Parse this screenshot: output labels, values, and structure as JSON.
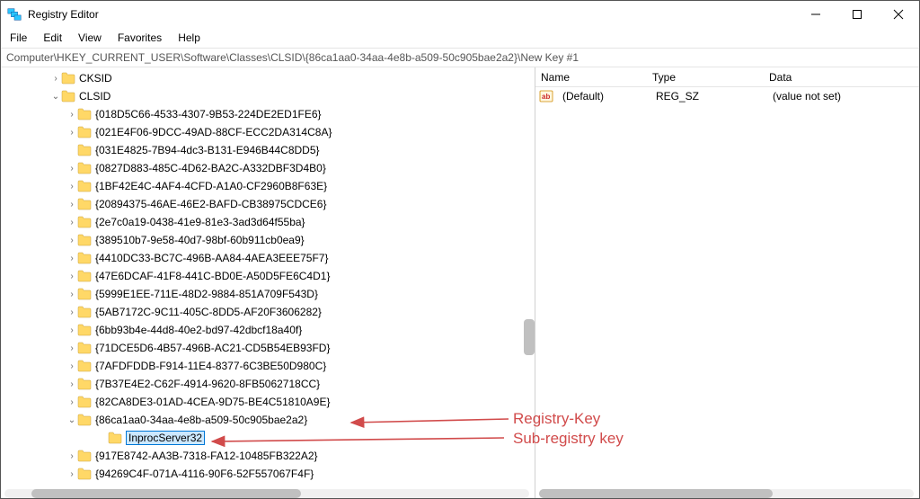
{
  "window_title": "Registry Editor",
  "menu": {
    "file": "File",
    "edit": "Edit",
    "view": "View",
    "favorites": "Favorites",
    "help": "Help"
  },
  "address_path": "Computer\\HKEY_CURRENT_USER\\Software\\Classes\\CLSID\\{86ca1aa0-34aa-4e8b-a509-50c905bae2a2}\\New Key #1",
  "tree": {
    "top1": "CKSID",
    "clsid": "CLSID",
    "keys": [
      "{018D5C66-4533-4307-9B53-224DE2ED1FE6}",
      "{021E4F06-9DCC-49AD-88CF-ECC2DA314C8A}",
      "{031E4825-7B94-4dc3-B131-E946B44C8DD5}",
      "{0827D883-485C-4D62-BA2C-A332DBF3D4B0}",
      "{1BF42E4C-4AF4-4CFD-A1A0-CF2960B8F63E}",
      "{20894375-46AE-46E2-BAFD-CB38975CDCE6}",
      "{2e7c0a19-0438-41e9-81e3-3ad3d64f55ba}",
      "{389510b7-9e58-40d7-98bf-60b911cb0ea9}",
      "{4410DC33-BC7C-496B-AA84-4AEA3EEE75F7}",
      "{47E6DCAF-41F8-441C-BD0E-A50D5FE6C4D1}",
      "{5999E1EE-711E-48D2-9884-851A709F543D}",
      "{5AB7172C-9C11-405C-8DD5-AF20F3606282}",
      "{6bb93b4e-44d8-40e2-bd97-42dbcf18a40f}",
      "{71DCE5D6-4B57-496B-AC21-CD5B54EB93FD}",
      "{7AFDFDDB-F914-11E4-8377-6C3BE50D980C}",
      "{7B37E4E2-C62F-4914-9620-8FB5062718CC}",
      "{82CA8DE3-01AD-4CEA-9D75-BE4C51810A9E}"
    ],
    "selected_parent": "{86ca1aa0-34aa-4e8b-a509-50c905bae2a2}",
    "editing_child": "InprocServer32",
    "tail": [
      "{917E8742-AA3B-7318-FA12-10485FB322A2}",
      "{94269C4F-071A-4116-90F6-52F557067F4F}"
    ]
  },
  "list": {
    "headers": {
      "name": "Name",
      "type": "Type",
      "data": "Data"
    },
    "rows": [
      {
        "name": "(Default)",
        "type": "REG_SZ",
        "data": "(value not set)"
      }
    ]
  },
  "annotations": {
    "label1": "Registry-Key",
    "label2": "Sub-registry key"
  }
}
